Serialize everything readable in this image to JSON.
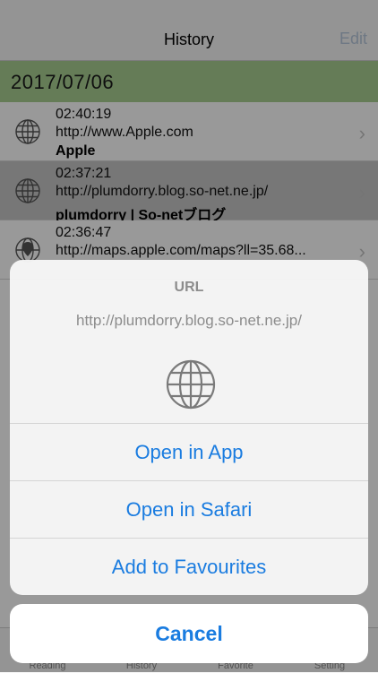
{
  "nav": {
    "title": "History",
    "edit": "Edit"
  },
  "section": {
    "date": "2017/07/06"
  },
  "rows": [
    {
      "time": "02:40:19",
      "url": "http://www.Apple.com",
      "title": "Apple",
      "icon": "globe-icon"
    },
    {
      "time": "02:37:21",
      "url": "http://plumdorry.blog.so-net.ne.jp/",
      "title": "plumdorry | So-netブログ",
      "icon": "globe-icon",
      "selected": true
    },
    {
      "time": "02:36:47",
      "url": "http://maps.apple.com/maps?ll=35.68...",
      "title": "",
      "icon": "map-globe-icon"
    }
  ],
  "tabs": [
    "Reading",
    "History",
    "Favorite",
    "Setting"
  ],
  "sheet": {
    "title": "URL",
    "message": "http://plumdorry.blog.so-net.ne.jp/",
    "icon": "globe-icon",
    "actions": [
      "Open in App",
      "Open in Safari",
      "Add to Favourites"
    ],
    "cancel": "Cancel"
  },
  "colors": {
    "accent": "#1a7ce0",
    "section": "#a9cf92"
  }
}
